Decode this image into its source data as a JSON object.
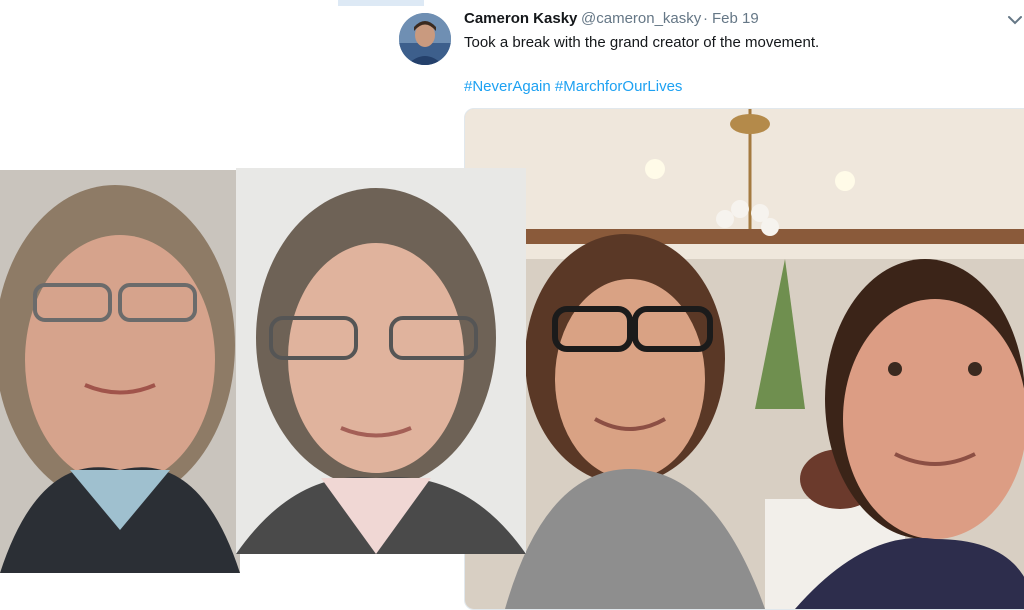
{
  "tweet": {
    "author_name": "Cameron Kasky",
    "author_handle": "@cameron_kasky",
    "separator": "·",
    "date": "Feb 19",
    "text": "Took a break with the grand creator of the movement.",
    "hashtags": [
      "#NeverAgain",
      "#MarchforOurLives"
    ],
    "menu_icon": "chevron-down-icon",
    "link_color": "#1da1f2"
  }
}
